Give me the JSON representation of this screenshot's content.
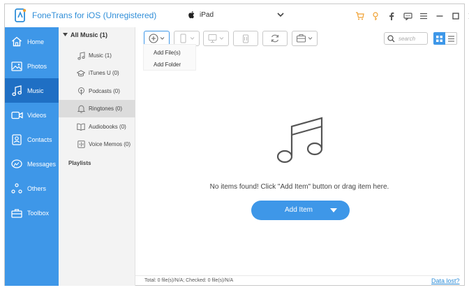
{
  "titlebar": {
    "app_title": "FoneTrans for iOS (Unregistered)",
    "device_name": "iPad"
  },
  "colors": {
    "accent": "#3e97e8",
    "accent_dark": "#1f6fc4",
    "orange": "#f0a030"
  },
  "sidebar": {
    "items": [
      {
        "label": "Home",
        "icon": "home-icon"
      },
      {
        "label": "Photos",
        "icon": "photo-icon"
      },
      {
        "label": "Music",
        "icon": "music-note-icon",
        "active": true
      },
      {
        "label": "Videos",
        "icon": "video-camera-icon"
      },
      {
        "label": "Contacts",
        "icon": "contacts-icon"
      },
      {
        "label": "Messages",
        "icon": "message-icon"
      },
      {
        "label": "Others",
        "icon": "others-icon"
      },
      {
        "label": "Toolbox",
        "icon": "toolbox-icon"
      }
    ]
  },
  "subpanel": {
    "header": "All Music (1)",
    "items": [
      {
        "label": "Music (1)",
        "icon": "music-note-icon"
      },
      {
        "label": "iTunes U (0)",
        "icon": "graduation-cap-icon"
      },
      {
        "label": "Podcasts (0)",
        "icon": "podcast-icon"
      },
      {
        "label": "Ringtones (0)",
        "icon": "bell-icon",
        "active": true
      },
      {
        "label": "Audiobooks (0)",
        "icon": "book-icon"
      },
      {
        "label": "Voice Memos (0)",
        "icon": "voice-memo-icon"
      }
    ],
    "playlists": "Playlists"
  },
  "dropdown": {
    "add_files": "Add File(s)",
    "add_folder": "Add Folder"
  },
  "search": {
    "placeholder": "search"
  },
  "main": {
    "empty_message": "No items found! Click \"Add Item\" button or drag item here.",
    "add_item_label": "Add Item"
  },
  "statusbar": {
    "text": "Total: 0 file(s)/N/A; Checked: 0 file(s)/N/A",
    "data_lost": "Data lost?"
  }
}
